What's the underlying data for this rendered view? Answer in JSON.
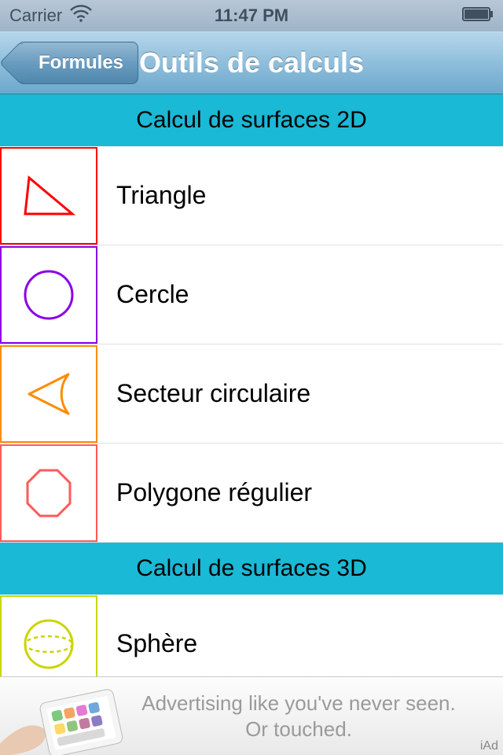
{
  "status_bar": {
    "carrier": "Carrier",
    "time": "11:47 PM"
  },
  "nav": {
    "back_label": "Formules",
    "title": "Outils de calculs"
  },
  "sections": [
    {
      "header": "Calcul de surfaces 2D",
      "rows": [
        {
          "label": "Triangle",
          "icon": "triangle",
          "border": "#ff0000",
          "stroke": "#ff0000"
        },
        {
          "label": "Cercle",
          "icon": "circle",
          "border": "#8a00e6",
          "stroke": "#8a00e6"
        },
        {
          "label": "Secteur circulaire",
          "icon": "sector",
          "border": "#ff8c00",
          "stroke": "#ff8c00"
        },
        {
          "label": "Polygone régulier",
          "icon": "octagon",
          "border": "#ff5a5a",
          "stroke": "#ff5a5a"
        }
      ]
    },
    {
      "header": "Calcul de surfaces 3D",
      "rows": [
        {
          "label": "Sphère",
          "icon": "sphere",
          "border": "#c9d600",
          "stroke": "#c9d600"
        }
      ]
    }
  ],
  "ad": {
    "line1": "Advertising like you've never seen.",
    "line2": "Or touched.",
    "mark": "iAd"
  }
}
